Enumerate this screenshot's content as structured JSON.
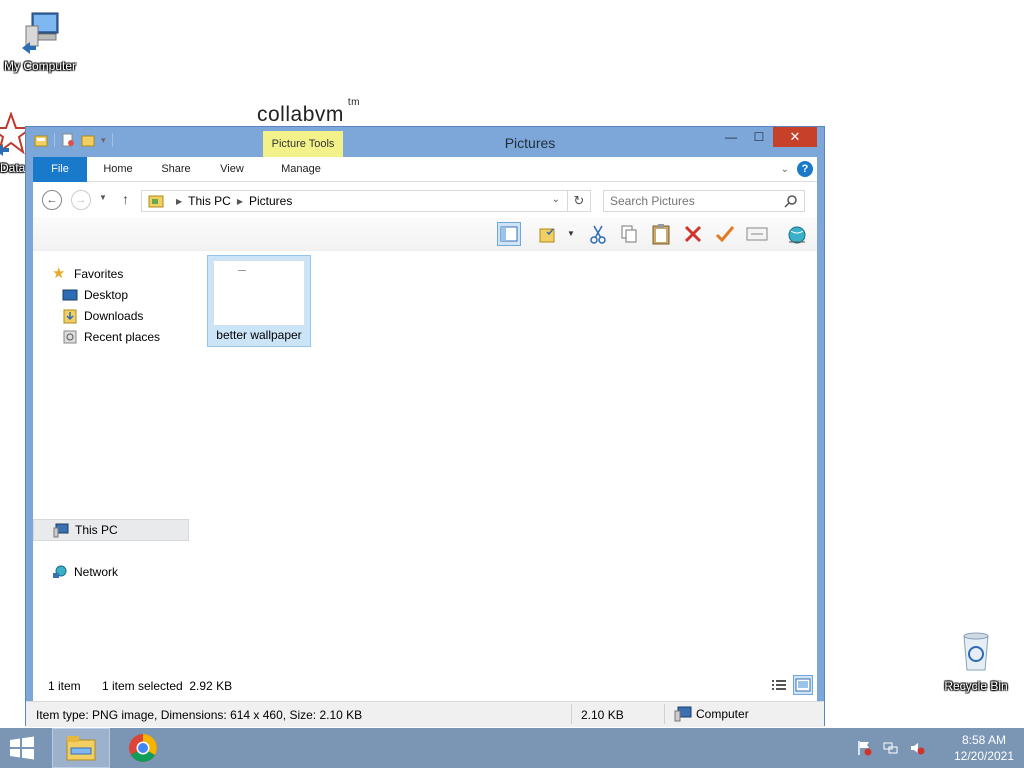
{
  "desktop": {
    "icons": [
      {
        "label": "My Computer"
      },
      {
        "label": "Data"
      },
      {
        "label": "Recycle Bin"
      }
    ],
    "brand": "collabvm",
    "brand_sup": "tm"
  },
  "window": {
    "title": "Pictures",
    "context_tab": "Picture Tools",
    "controls": {
      "minimize": "—",
      "maximize": "☐",
      "close": "✕"
    },
    "ribbon_tabs": [
      "File",
      "Home",
      "Share",
      "View",
      "Manage"
    ],
    "help": "?",
    "address": {
      "crumbs": [
        "This PC",
        "Pictures"
      ]
    },
    "search": {
      "placeholder": "Search Pictures"
    },
    "nav_pane": {
      "favorites": "Favorites",
      "items": [
        "Desktop",
        "Downloads",
        "Recent places"
      ],
      "this_pc": "This PC",
      "network": "Network"
    },
    "files": [
      {
        "name": "better wallpaper"
      }
    ],
    "status": {
      "count": "1 item",
      "selected": "1 item selected  2.92 KB"
    },
    "details": {
      "info": "Item type: PNG image, Dimensions: 614 x 460, Size: 2.10 KB",
      "size": "2.10 KB",
      "location": "Computer"
    }
  },
  "taskbar": {
    "time": "8:58 AM",
    "date": "12/20/2021"
  },
  "colors": {
    "accent": "#1979ca",
    "taskbar": "#7b95b5",
    "close": "#c6402a"
  }
}
